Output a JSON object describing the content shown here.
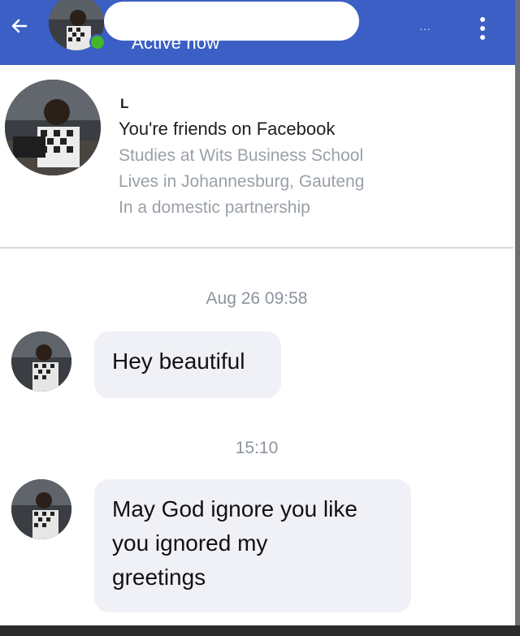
{
  "header": {
    "status": "Active now",
    "menu_dots": "..."
  },
  "profile": {
    "name_initial": "L",
    "friends_text": "You're friends on Facebook",
    "studies": "Studies at Wits Business School",
    "lives": "Lives in Johannesburg, Gauteng",
    "relationship": "In a domestic partnership"
  },
  "conversation": {
    "timestamp_1": "Aug 26 09:58",
    "message_1": "Hey beautiful",
    "timestamp_2": "15:10",
    "message_2_line_1": "May God ignore you like",
    "message_2_line_2": "you ignored my",
    "message_2_line_3": "greetings"
  },
  "colors": {
    "header_bg": "#3b5fc4",
    "presence": "#42b72a",
    "bubble_bg": "#f0f1f6",
    "muted_text": "#9aa0a8"
  },
  "icons": {
    "back": "arrow-left-icon",
    "menu": "more-vertical-icon"
  }
}
